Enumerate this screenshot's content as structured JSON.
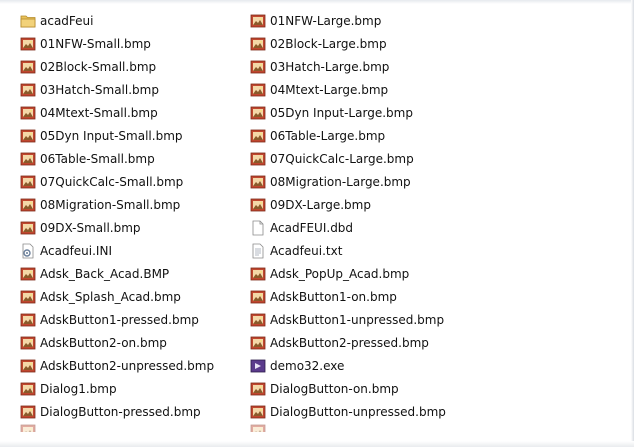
{
  "files_left": [
    {
      "name": "acadFeui",
      "icon": "folder"
    },
    {
      "name": "01NFW-Small.bmp",
      "icon": "bmp"
    },
    {
      "name": "02Block-Small.bmp",
      "icon": "bmp"
    },
    {
      "name": "03Hatch-Small.bmp",
      "icon": "bmp"
    },
    {
      "name": "04Mtext-Small.bmp",
      "icon": "bmp"
    },
    {
      "name": "05Dyn Input-Small.bmp",
      "icon": "bmp"
    },
    {
      "name": "06Table-Small.bmp",
      "icon": "bmp"
    },
    {
      "name": "07QuickCalc-Small.bmp",
      "icon": "bmp"
    },
    {
      "name": "08Migration-Small.bmp",
      "icon": "bmp"
    },
    {
      "name": "09DX-Small.bmp",
      "icon": "bmp"
    },
    {
      "name": "Acadfeui.INI",
      "icon": "ini"
    },
    {
      "name": "Adsk_Back_Acad.BMP",
      "icon": "bmp"
    },
    {
      "name": "Adsk_Splash_Acad.bmp",
      "icon": "bmp"
    },
    {
      "name": "AdskButton1-pressed.bmp",
      "icon": "bmp"
    },
    {
      "name": "AdskButton2-on.bmp",
      "icon": "bmp"
    },
    {
      "name": "AdskButton2-unpressed.bmp",
      "icon": "bmp"
    },
    {
      "name": "Dialog1.bmp",
      "icon": "bmp"
    },
    {
      "name": "DialogButton-pressed.bmp",
      "icon": "bmp"
    }
  ],
  "files_right": [
    {
      "name": "01NFW-Large.bmp",
      "icon": "bmp"
    },
    {
      "name": "02Block-Large.bmp",
      "icon": "bmp"
    },
    {
      "name": "03Hatch-Large.bmp",
      "icon": "bmp"
    },
    {
      "name": "04Mtext-Large.bmp",
      "icon": "bmp"
    },
    {
      "name": "05Dyn Input-Large.bmp",
      "icon": "bmp"
    },
    {
      "name": "06Table-Large.bmp",
      "icon": "bmp"
    },
    {
      "name": "07QuickCalc-Large.bmp",
      "icon": "bmp"
    },
    {
      "name": "08Migration-Large.bmp",
      "icon": "bmp"
    },
    {
      "name": "09DX-Large.bmp",
      "icon": "bmp"
    },
    {
      "name": "AcadFEUI.dbd",
      "icon": "file"
    },
    {
      "name": "Acadfeui.txt",
      "icon": "txt"
    },
    {
      "name": "Adsk_PopUp_Acad.bmp",
      "icon": "bmp"
    },
    {
      "name": "AdskButton1-on.bmp",
      "icon": "bmp"
    },
    {
      "name": "AdskButton1-unpressed.bmp",
      "icon": "bmp"
    },
    {
      "name": "AdskButton2-pressed.bmp",
      "icon": "bmp"
    },
    {
      "name": "demo32.exe",
      "icon": "exe"
    },
    {
      "name": "DialogButton-on.bmp",
      "icon": "bmp"
    },
    {
      "name": "DialogButton-unpressed.bmp",
      "icon": "bmp"
    }
  ],
  "colors": {
    "folder": "#e8c15a",
    "bmp_frame": "#c0472f",
    "bmp_inner": "#f4d7a8",
    "exe": "#5b3b8c",
    "text": "#111111"
  }
}
